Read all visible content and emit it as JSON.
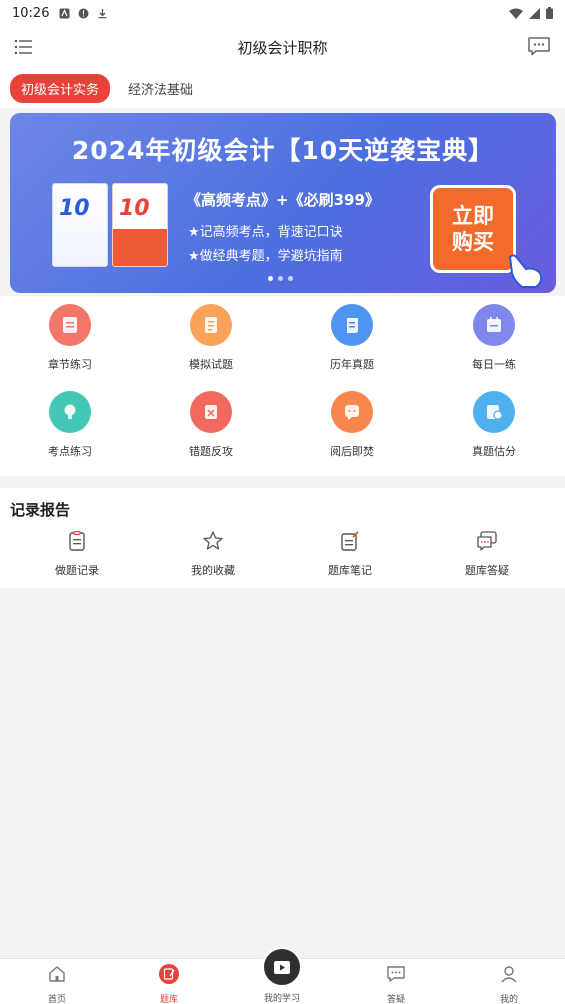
{
  "status_bar": {
    "time": "10:26"
  },
  "header": {
    "title": "初级会计职称"
  },
  "subject_tabs": [
    {
      "label": "初级会计实务",
      "active": true
    },
    {
      "label": "经济法基础",
      "active": false
    }
  ],
  "banner": {
    "title": "2024年初级会计【10天逆袭宝典】",
    "book1_number": "10",
    "book2_number": "10",
    "line1": "《高频考点》+《必刷399》",
    "line2": "★记高频考点，背速记口诀",
    "line3": "★做经典考题，学避坑指南",
    "buy_line1": "立即",
    "buy_line2": "购买",
    "active_dot": 0
  },
  "features": [
    {
      "label": "章节练习",
      "icon": "document-icon",
      "color": "#f2766a"
    },
    {
      "label": "模拟试题",
      "icon": "exam-paper-icon",
      "color": "#f7a35a"
    },
    {
      "label": "历年真题",
      "icon": "scroll-icon",
      "color": "#4f94f0"
    },
    {
      "label": "每日一练",
      "icon": "calendar-icon",
      "color": "#7f86ec"
    },
    {
      "label": "考点练习",
      "icon": "lightbulb-icon",
      "color": "#45c7b5"
    },
    {
      "label": "错题反攻",
      "icon": "error-book-icon",
      "color": "#f26a5e"
    },
    {
      "label": "阅后即焚",
      "icon": "flame-chat-icon",
      "color": "#f8874e"
    },
    {
      "label": "真题估分",
      "icon": "estimate-icon",
      "color": "#4fb0f0"
    }
  ],
  "records": {
    "title": "记录报告",
    "items": [
      {
        "label": "做题记录",
        "icon": "clipboard-icon"
      },
      {
        "label": "我的收藏",
        "icon": "star-icon"
      },
      {
        "label": "题库笔记",
        "icon": "note-edit-icon"
      },
      {
        "label": "题库答疑",
        "icon": "chat-bubble-icon"
      }
    ]
  },
  "bottom_nav": {
    "items": [
      {
        "label": "首页",
        "icon": "home-icon",
        "active": false
      },
      {
        "label": "题库",
        "icon": "question-bank-icon",
        "active": true
      },
      {
        "label": "我的学习",
        "icon": "play-tv-icon",
        "active": false
      },
      {
        "label": "答疑",
        "icon": "chat-icon",
        "active": false
      },
      {
        "label": "我的",
        "icon": "user-icon",
        "active": false
      }
    ]
  },
  "colors": {
    "accent": "#e8423a",
    "banner": "#4d6fdf"
  }
}
